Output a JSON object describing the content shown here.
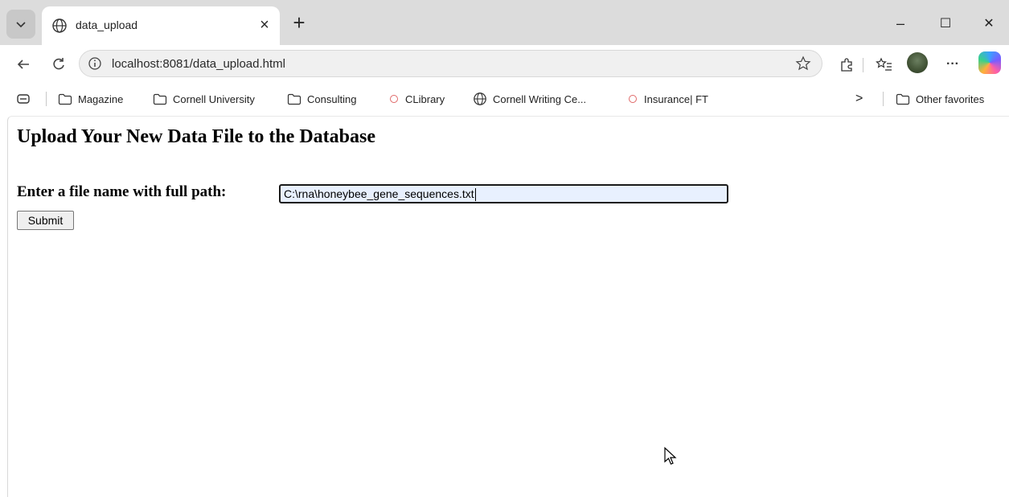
{
  "browser": {
    "tab_title": "data_upload",
    "tab_close": "×",
    "new_tab": "+",
    "address": "localhost:8081/data_upload.html",
    "more_label": "···",
    "window_min": "–",
    "window_max": "☐",
    "window_close": "✕"
  },
  "favorites": {
    "items": [
      {
        "label": "Magazine",
        "icon": "folder-icon"
      },
      {
        "label": "Cornell University",
        "icon": "folder-icon"
      },
      {
        "label": "Consulting",
        "icon": "folder-icon"
      },
      {
        "label": "CLibrary",
        "icon": "site-dot-icon"
      },
      {
        "label": "Cornell Writing Ce...",
        "icon": "globe-icon"
      },
      {
        "label": "Insurance| FT",
        "icon": "site-dot-icon"
      }
    ],
    "overflow": ">",
    "other_label": "Other favorites"
  },
  "page": {
    "title": "Upload Your New Data File to the Database",
    "file_label": "Enter a file name with full path:",
    "file_value": "C:\\rna\\honeybee_gene_sequences.txt",
    "submit_label": "Submit"
  }
}
